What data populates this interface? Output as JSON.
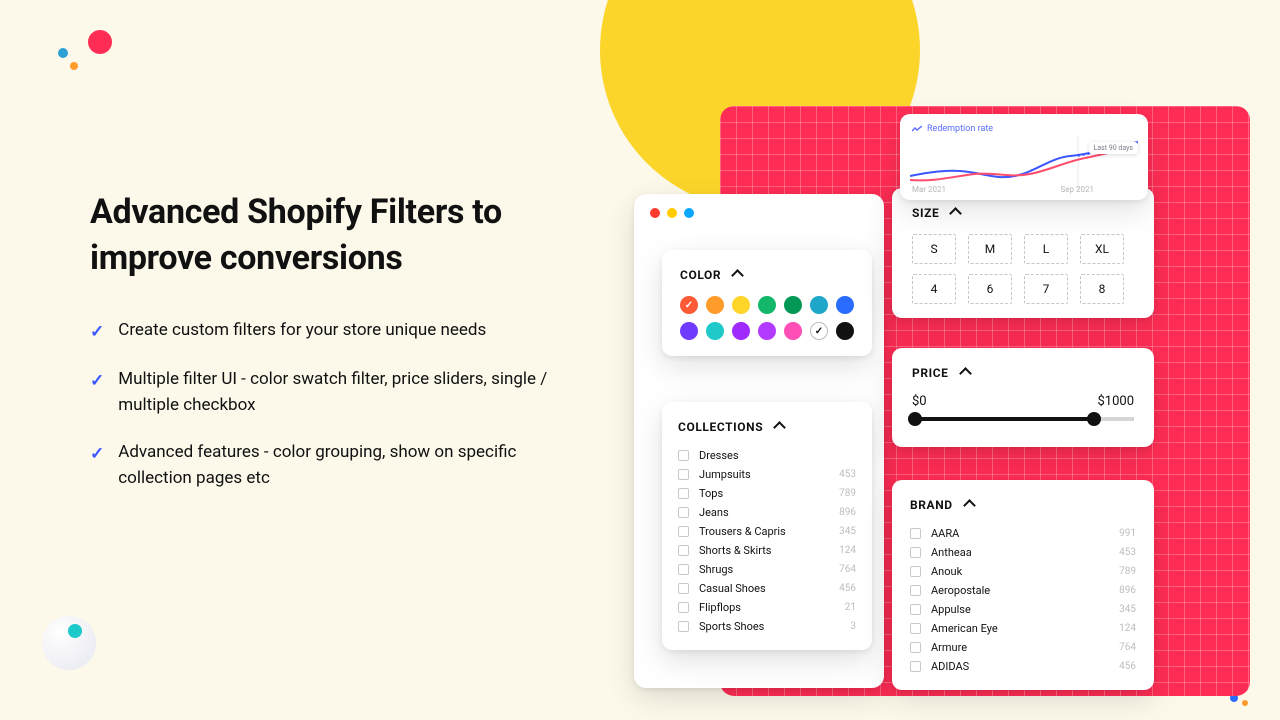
{
  "headline": "Advanced Shopify Filters to improve conversions",
  "bullets": [
    "Create custom filters for your store unique needs",
    "Multiple filter UI - color swatch filter, price sliders, single / multiple checkbox",
    "Advanced features - color grouping, show on specific collection pages etc"
  ],
  "color": {
    "title": "COLOR",
    "swatches": [
      {
        "hex": "#ff5a36",
        "selected": true
      },
      {
        "hex": "#ff9b2a"
      },
      {
        "hex": "#ffd52a"
      },
      {
        "hex": "#12b76a"
      },
      {
        "hex": "#039855"
      },
      {
        "hex": "#1ea7c9"
      },
      {
        "hex": "#2a6cff"
      },
      {
        "hex": "#6f3bff"
      },
      {
        "hex": "#1ec9c9"
      },
      {
        "hex": "#9f2bff"
      },
      {
        "hex": "#b23bff"
      },
      {
        "hex": "#ff4fb6"
      },
      {
        "hex": "#ffffff",
        "outline": true
      },
      {
        "hex": "#111111"
      }
    ]
  },
  "size": {
    "title": "SIZE",
    "row1": [
      "S",
      "M",
      "L",
      "XL"
    ],
    "row2": [
      "4",
      "6",
      "7",
      "8"
    ]
  },
  "price": {
    "title": "PRICE",
    "min": "$0",
    "max": "$1000"
  },
  "collections": {
    "title": "COLLECTIONS",
    "items": [
      {
        "label": "Dresses",
        "count": ""
      },
      {
        "label": "Jumpsuits",
        "count": "453"
      },
      {
        "label": "Tops",
        "count": "789"
      },
      {
        "label": "Jeans",
        "count": "896"
      },
      {
        "label": "Trousers & Capris",
        "count": "345"
      },
      {
        "label": "Shorts & Skirts",
        "count": "124"
      },
      {
        "label": "Shrugs",
        "count": "764"
      },
      {
        "label": "Casual Shoes",
        "count": "456"
      },
      {
        "label": "Flipflops",
        "count": "21"
      },
      {
        "label": "Sports Shoes",
        "count": "3"
      }
    ]
  },
  "brand": {
    "title": "BRAND",
    "items": [
      {
        "label": "AARA",
        "count": "991"
      },
      {
        "label": "Antheaa",
        "count": "453"
      },
      {
        "label": "Anouk",
        "count": "789"
      },
      {
        "label": "Aeropostale",
        "count": "896"
      },
      {
        "label": "Appulse",
        "count": "345"
      },
      {
        "label": "American Eye",
        "count": "124"
      },
      {
        "label": "Armure",
        "count": "764"
      },
      {
        "label": "ADIDAS",
        "count": "456"
      }
    ]
  },
  "chart": {
    "title": "Redemption rate",
    "left_label": "Mar 2021",
    "right_label": "Sep 2021",
    "badge": "Last 90 days"
  }
}
